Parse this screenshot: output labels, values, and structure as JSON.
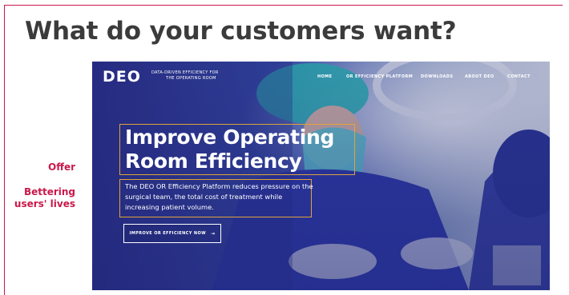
{
  "slide": {
    "title": "What do your customers want?",
    "side_labels": {
      "offer": "Offer",
      "bettering": "Bettering users' lives"
    },
    "accent_color": "#c9184a"
  },
  "website": {
    "logo": "DEO",
    "tagline_line1": "DATA-DRIVEN EFFICIENCY FOR",
    "tagline_line2": "THE OPERATING ROOM",
    "nav": [
      "HOME",
      "OR EFFICIENCY PLATFORM",
      "DOWNLOADS",
      "ABOUT DEO",
      "CONTACT"
    ],
    "hero_heading_line1": "Improve Operating",
    "hero_heading_line2": "Room Efficiency",
    "hero_body": "The DEO OR Efficiency Platform reduces pressure on the surgical team, the total cost of treatment while increasing patient volume.",
    "cta_label": "IMPROVE OR EFFICIENCY NOW",
    "cta_icon": "arrow-right-icon",
    "highlight_color": "#e0a33b"
  }
}
